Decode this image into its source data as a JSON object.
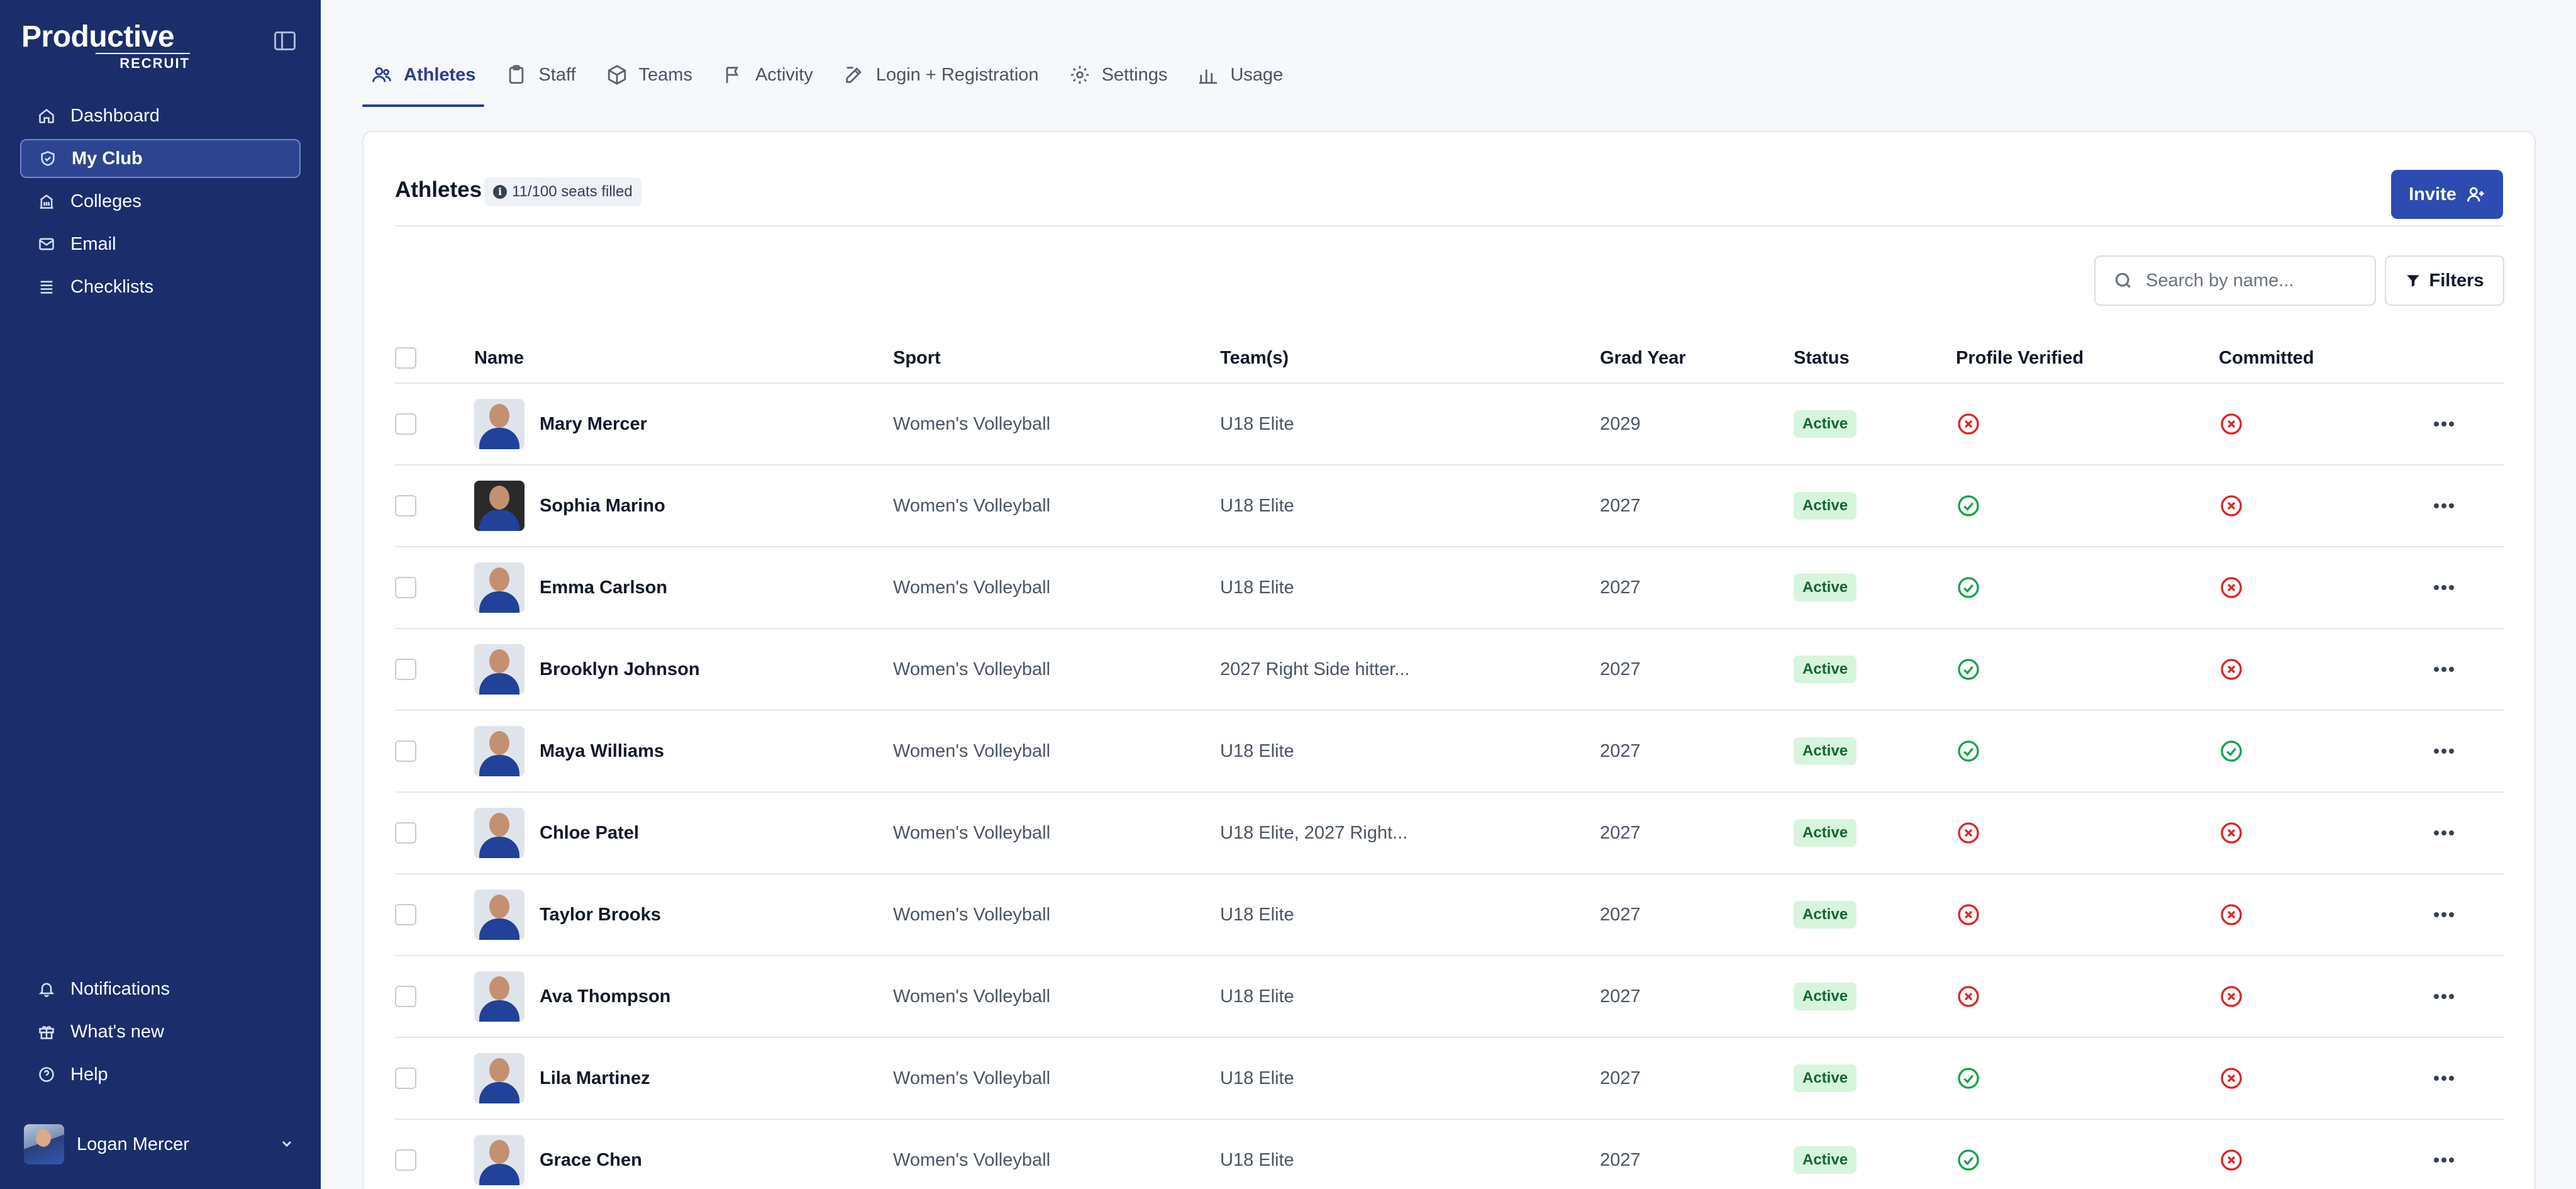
{
  "app": {
    "logo_main": "Productive",
    "logo_sub": "RECRUIT"
  },
  "sidebar": {
    "items": [
      {
        "label": "Dashboard",
        "icon": "home-icon",
        "active": false
      },
      {
        "label": "My Club",
        "icon": "shield-icon",
        "active": true
      },
      {
        "label": "Colleges",
        "icon": "building-icon",
        "active": false
      },
      {
        "label": "Email",
        "icon": "mail-icon",
        "active": false
      },
      {
        "label": "Checklists",
        "icon": "list-icon",
        "active": false
      }
    ],
    "bottom_items": [
      {
        "label": "Notifications",
        "icon": "bell-icon"
      },
      {
        "label": "What's new",
        "icon": "gift-icon"
      },
      {
        "label": "Help",
        "icon": "help-icon"
      }
    ],
    "user_name": "Logan Mercer"
  },
  "tabs": [
    {
      "label": "Athletes",
      "icon": "users-icon",
      "active": true
    },
    {
      "label": "Staff",
      "icon": "clipboard-icon",
      "active": false
    },
    {
      "label": "Teams",
      "icon": "cube-icon",
      "active": false
    },
    {
      "label": "Activity",
      "icon": "flag-icon",
      "active": false
    },
    {
      "label": "Login + Registration",
      "icon": "edit-icon",
      "active": false
    },
    {
      "label": "Settings",
      "icon": "gear-icon",
      "active": false
    },
    {
      "label": "Usage",
      "icon": "bar-chart-icon",
      "active": false
    }
  ],
  "card": {
    "title": "Athletes",
    "seats": "11/100 seats filled",
    "invite_label": "Invite",
    "search_placeholder": "Search by name...",
    "filters_label": "Filters"
  },
  "table": {
    "columns": [
      "Name",
      "Sport",
      "Team(s)",
      "Grad Year",
      "Status",
      "Profile Verified",
      "Committed"
    ],
    "rows": [
      {
        "name": "Mary Mercer",
        "sport": "Women's Volleyball",
        "teams": "U18 Elite",
        "grad_year": "2029",
        "status": "Active",
        "verified": false,
        "committed": false
      },
      {
        "name": "Sophia Marino",
        "sport": "Women's Volleyball",
        "teams": "U18 Elite",
        "grad_year": "2027",
        "status": "Active",
        "verified": true,
        "committed": false
      },
      {
        "name": "Emma Carlson",
        "sport": "Women's Volleyball",
        "teams": "U18 Elite",
        "grad_year": "2027",
        "status": "Active",
        "verified": true,
        "committed": false
      },
      {
        "name": "Brooklyn Johnson",
        "sport": "Women's Volleyball",
        "teams": "2027 Right Side hitter...",
        "grad_year": "2027",
        "status": "Active",
        "verified": true,
        "committed": false
      },
      {
        "name": "Maya Williams",
        "sport": "Women's Volleyball",
        "teams": "U18 Elite",
        "grad_year": "2027",
        "status": "Active",
        "verified": true,
        "committed": true
      },
      {
        "name": "Chloe Patel",
        "sport": "Women's Volleyball",
        "teams": "U18 Elite, 2027 Right...",
        "grad_year": "2027",
        "status": "Active",
        "verified": false,
        "committed": false
      },
      {
        "name": "Taylor Brooks",
        "sport": "Women's Volleyball",
        "teams": "U18 Elite",
        "grad_year": "2027",
        "status": "Active",
        "verified": false,
        "committed": false
      },
      {
        "name": "Ava Thompson",
        "sport": "Women's Volleyball",
        "teams": "U18 Elite",
        "grad_year": "2027",
        "status": "Active",
        "verified": false,
        "committed": false
      },
      {
        "name": "Lila Martinez",
        "sport": "Women's Volleyball",
        "teams": "U18 Elite",
        "grad_year": "2027",
        "status": "Active",
        "verified": true,
        "committed": false
      },
      {
        "name": "Grace Chen",
        "sport": "Women's Volleyball",
        "teams": "U18 Elite",
        "grad_year": "2027",
        "status": "Active",
        "verified": true,
        "committed": false
      }
    ]
  },
  "colors": {
    "sidebar": "#1b2e6b",
    "accent": "#2d4bb1",
    "success": "#16a34a",
    "danger": "#dc2626"
  }
}
